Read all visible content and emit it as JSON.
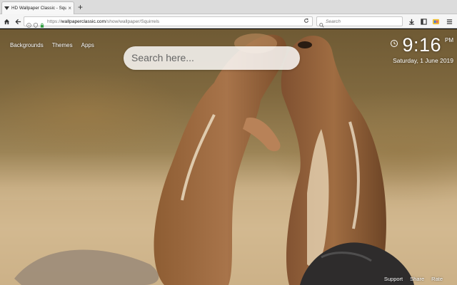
{
  "browser": {
    "tab": {
      "title": "HD Wallpaper Classic - Squ",
      "close_glyph": "×",
      "favicon": "wallpaper-classic-favicon"
    },
    "new_tab_glyph": "+",
    "url": {
      "prefix": "https://",
      "domain": "wallpaperclassic.com",
      "path": "/show/wallpaper/Squirrels"
    },
    "search": {
      "placeholder": "Search"
    },
    "icons": [
      "home-icon",
      "back-icon",
      "info-icon",
      "shield-icon",
      "lock-icon",
      "reload-icon",
      "search-icon",
      "download-icon",
      "reader-icon",
      "extension-icon",
      "menu-icon"
    ]
  },
  "page": {
    "nav": {
      "backgrounds": "Backgrounds",
      "themes": "Themes",
      "apps": "Apps"
    },
    "search": {
      "placeholder": "Search here..."
    },
    "clock": {
      "time": "9:16",
      "ampm": "PM",
      "date": "Saturday, 1 June 2019",
      "icon": "alarm-icon"
    },
    "footer": {
      "support": "Support",
      "share": "Share",
      "rate": "Rate"
    }
  }
}
